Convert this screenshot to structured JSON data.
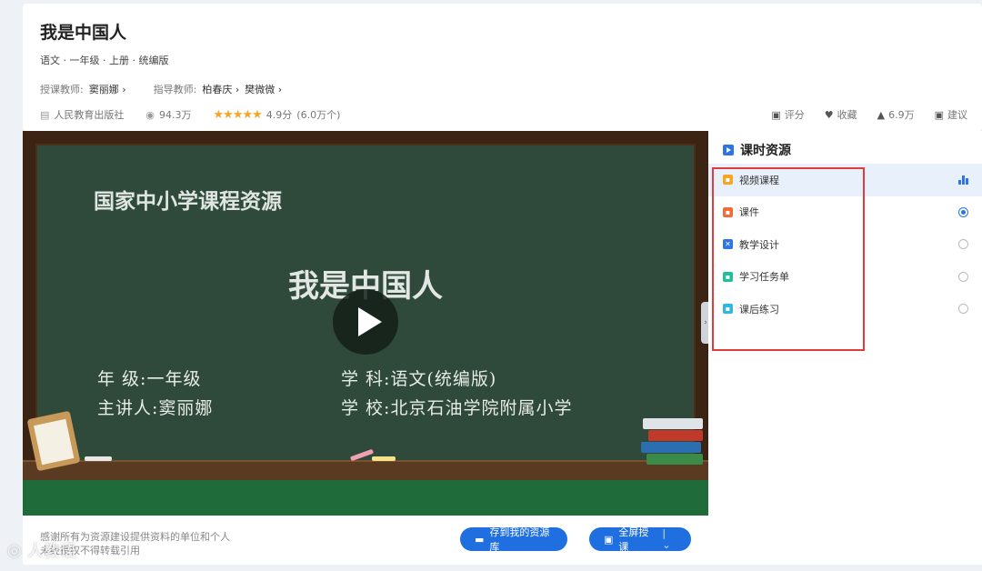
{
  "lesson": {
    "title": "我是中国人",
    "subtitle": "语文 · 一年级 · 上册 · 统编版",
    "teacher_label": "授课教师:",
    "teacher_name": "窦丽娜 ›",
    "guide_label": "指导教师:",
    "guide_name_1": "柏春庆 ›",
    "guide_name_2": "樊微微 ›",
    "publisher": "人民教育出版社",
    "views": "94.3万",
    "stars": "★★★★★",
    "rating": "4.9分",
    "rating_count": "(6.0万个)"
  },
  "actions": {
    "rate": "评分",
    "favorite": "收藏",
    "likes": "6.9万",
    "suggest": "建议"
  },
  "board": {
    "logo_text": "国家中小学课程资源",
    "title": "我是中国人",
    "grade": "年  级:一年级",
    "subject": "学  科:语文(统编版)",
    "speaker": "主讲人:窦丽娜",
    "school": "学  校:北京石油学院附属小学"
  },
  "footer": {
    "thanks_line1": "感谢所有为资源建设提供资料的单位和个人",
    "thanks_line2": "未经授权不得转载引用",
    "save_button": "存到我的资源库",
    "fullscreen_button": "全屏授课",
    "dropdown": "|  ⌄"
  },
  "panel": {
    "title": "课时资源",
    "items": [
      {
        "label": "视频课程",
        "icon_color": "#f5a623"
      },
      {
        "label": "课件",
        "icon_color": "#f26b3a"
      },
      {
        "label": "教学设计",
        "icon_color": "#2d74e6"
      },
      {
        "label": "学习任务单",
        "icon_color": "#1fbf9c"
      },
      {
        "label": "课后练习",
        "icon_color": "#2db6e6"
      }
    ]
  },
  "watermark": "人教语"
}
